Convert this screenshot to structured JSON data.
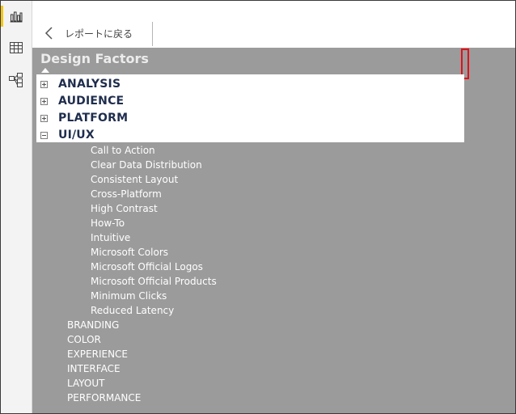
{
  "rail": {
    "icons": [
      "report-view-icon",
      "data-view-icon",
      "model-view-icon"
    ]
  },
  "header": {
    "back_label": "レポートに戻る"
  },
  "slicer": {
    "title": "Design Factors",
    "level1": [
      {
        "label": "ANALYSIS",
        "state": "collapsed"
      },
      {
        "label": "AUDIENCE",
        "state": "collapsed"
      },
      {
        "label": "PLATFORM",
        "state": "collapsed"
      },
      {
        "label": "UI/UX",
        "state": "expanded"
      }
    ],
    "uiux_children": [
      "Call to Action",
      "Clear Data Distribution",
      "Consistent Layout",
      "Cross-Platform",
      "High Contrast",
      "How-To",
      "Intuitive",
      "Microsoft Colors",
      "Microsoft Official Logos",
      "Microsoft Official Products",
      "Minimum Clicks",
      "Reduced Latency"
    ],
    "uiux_groups": [
      "BRANDING",
      "COLOR",
      "EXPERIENCE",
      "INTERFACE",
      "LAYOUT",
      "PERFORMANCE"
    ]
  },
  "colors": {
    "canvas": "#9b9b9b",
    "accent_focus": "#e4101a",
    "level1_text": "#1f2d4d"
  }
}
